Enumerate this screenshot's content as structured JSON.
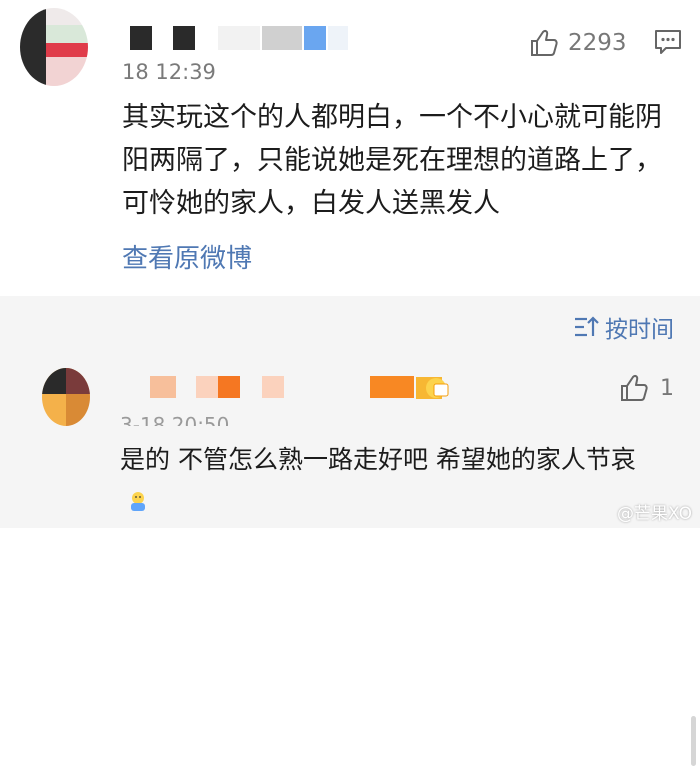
{
  "comment": {
    "time": "18 12:39",
    "like_count": "2293",
    "body": "其实玩这个的人都明白，一个不小心就可能阴阳两隔了，只能说她是死在理想的道路上了，可怜她的家人，白发人送黑发人",
    "view_original": "查看原微博"
  },
  "sort": {
    "label": "按时间"
  },
  "reply": {
    "time": "3-18 20:50",
    "like_count": "1",
    "body": "是的 不管怎么熟一路走好吧 希望她的家人节哀"
  },
  "watermark": {
    "text": "@芒果XO"
  },
  "colors": {
    "link": "#4f78b3",
    "divider_bg": "#f5f5f5"
  }
}
